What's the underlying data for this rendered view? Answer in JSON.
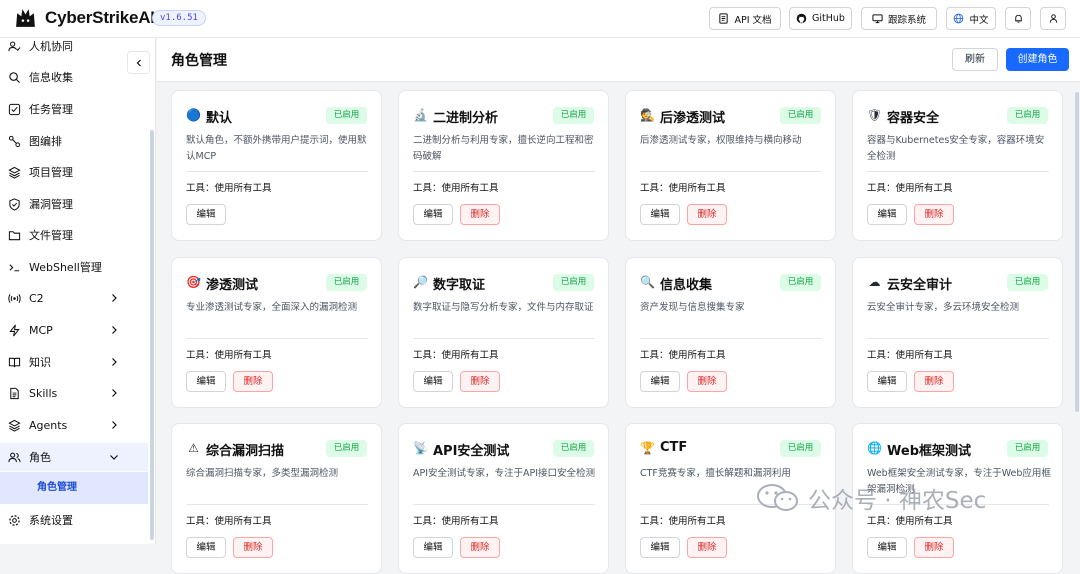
{
  "header": {
    "brand": "CyberStrikeAI",
    "version": "v1.6.51",
    "api_docs": "API 文档",
    "github": "GitHub",
    "tracking": "跟踪系统",
    "language": "中文"
  },
  "sidebar": {
    "items": [
      {
        "label": "人机协同"
      },
      {
        "label": "信息收集"
      },
      {
        "label": "任务管理"
      },
      {
        "label": "图编排"
      },
      {
        "label": "项目管理"
      },
      {
        "label": "漏洞管理"
      },
      {
        "label": "文件管理"
      },
      {
        "label": "WebShell管理"
      },
      {
        "label": "C2"
      },
      {
        "label": "MCP"
      },
      {
        "label": "知识"
      },
      {
        "label": "Skills"
      },
      {
        "label": "Agents"
      },
      {
        "label": "角色"
      },
      {
        "label": "系统设置"
      }
    ],
    "sub_active": "角色管理"
  },
  "main": {
    "title": "角色管理",
    "refresh": "刷新",
    "create": "创建角色"
  },
  "cards": [
    {
      "icon": "🔵",
      "name": "默认",
      "status": "已启用",
      "desc": "默认角色，不额外携带用户提示词，使用默认MCP",
      "tools": "工具：使用所有工具",
      "edit": "编辑",
      "delete": ""
    },
    {
      "icon": "🔬",
      "name": "二进制分析",
      "status": "已启用",
      "desc": "二进制分析与利用专家，擅长逆向工程和密码破解",
      "tools": "工具：使用所有工具",
      "edit": "编辑",
      "delete": "删除"
    },
    {
      "icon": "🕵",
      "name": "后渗透测试",
      "status": "已启用",
      "desc": "后渗透测试专家，权限维持与横向移动",
      "tools": "工具：使用所有工具",
      "edit": "编辑",
      "delete": "删除"
    },
    {
      "icon": "🛡",
      "name": "容器安全",
      "status": "已启用",
      "desc": "容器与Kubernetes安全专家，容器环境安全检测",
      "tools": "工具：使用所有工具",
      "edit": "编辑",
      "delete": "删除"
    },
    {
      "icon": "🎯",
      "name": "渗透测试",
      "status": "已启用",
      "desc": "专业渗透测试专家，全面深入的漏洞检测",
      "tools": "工具：使用所有工具",
      "edit": "编辑",
      "delete": "删除"
    },
    {
      "icon": "🔎",
      "name": "数字取证",
      "status": "已启用",
      "desc": "数字取证与隐写分析专家，文件与内存取证",
      "tools": "工具：使用所有工具",
      "edit": "编辑",
      "delete": "删除"
    },
    {
      "icon": "🔍",
      "name": "信息收集",
      "status": "已启用",
      "desc": "资产发现与信息搜集专家",
      "tools": "工具：使用所有工具",
      "edit": "编辑",
      "delete": "删除"
    },
    {
      "icon": "☁",
      "name": "云安全审计",
      "status": "已启用",
      "desc": "云安全审计专家，多云环境安全检测",
      "tools": "工具：使用所有工具",
      "edit": "编辑",
      "delete": "删除"
    },
    {
      "icon": "⚠",
      "name": "综合漏洞扫描",
      "status": "已启用",
      "desc": "综合漏洞扫描专家，多类型漏洞检测",
      "tools": "工具：使用所有工具",
      "edit": "编辑",
      "delete": "删除"
    },
    {
      "icon": "📡",
      "name": "API安全测试",
      "status": "已启用",
      "desc": "API安全测试专家，专注于API接口安全检测",
      "tools": "工具：使用所有工具",
      "edit": "编辑",
      "delete": "删除"
    },
    {
      "icon": "🏆",
      "name": "CTF",
      "status": "已启用",
      "desc": "CTF竞赛专家，擅长解题和漏洞利用",
      "tools": "工具：使用所有工具",
      "edit": "编辑",
      "delete": "删除"
    },
    {
      "icon": "🌐",
      "name": "Web框架测试",
      "status": "已启用",
      "desc": "Web框架安全测试专家，专注于Web应用框架漏洞检测",
      "tools": "工具：使用所有工具",
      "edit": "编辑",
      "delete": "删除"
    }
  ],
  "watermark": "公众号 · 神农Sec"
}
